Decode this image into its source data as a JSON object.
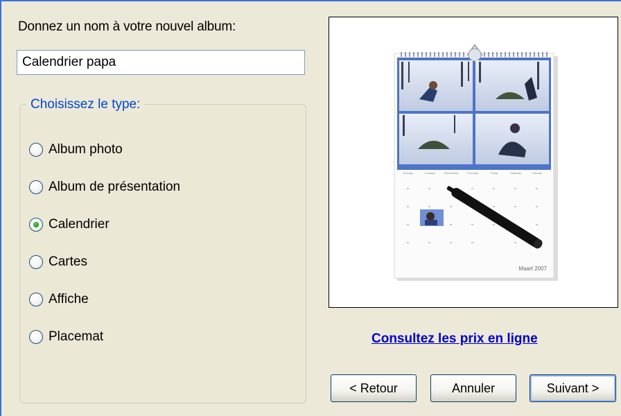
{
  "form": {
    "name_label": "Donnez un nom à votre nouvel album:",
    "name_value": "Calendrier papa"
  },
  "type_group": {
    "legend": "Choisissez le type:",
    "options": [
      {
        "label": "Album photo",
        "checked": false
      },
      {
        "label": "Album de présentation",
        "checked": false
      },
      {
        "label": "Calendrier",
        "checked": true
      },
      {
        "label": "Cartes",
        "checked": false
      },
      {
        "label": "Affiche",
        "checked": false
      },
      {
        "label": "Placemat",
        "checked": false
      }
    ]
  },
  "preview": {
    "weekdays": [
      "Monday",
      "Tuesday",
      "Wednesday",
      "Thursday",
      "Friday",
      "Saturday",
      "Sunday"
    ],
    "month_caption": "Maart 2007"
  },
  "price_link": "Consultez les prix en ligne",
  "buttons": {
    "back": "< Retour",
    "cancel": "Annuler",
    "next": "Suivant >"
  },
  "colors": {
    "accent_blue": "#0046d5",
    "link_blue": "#0000cc",
    "dialog_bg": "#ece9d8",
    "radio_checked": "#21a121"
  }
}
